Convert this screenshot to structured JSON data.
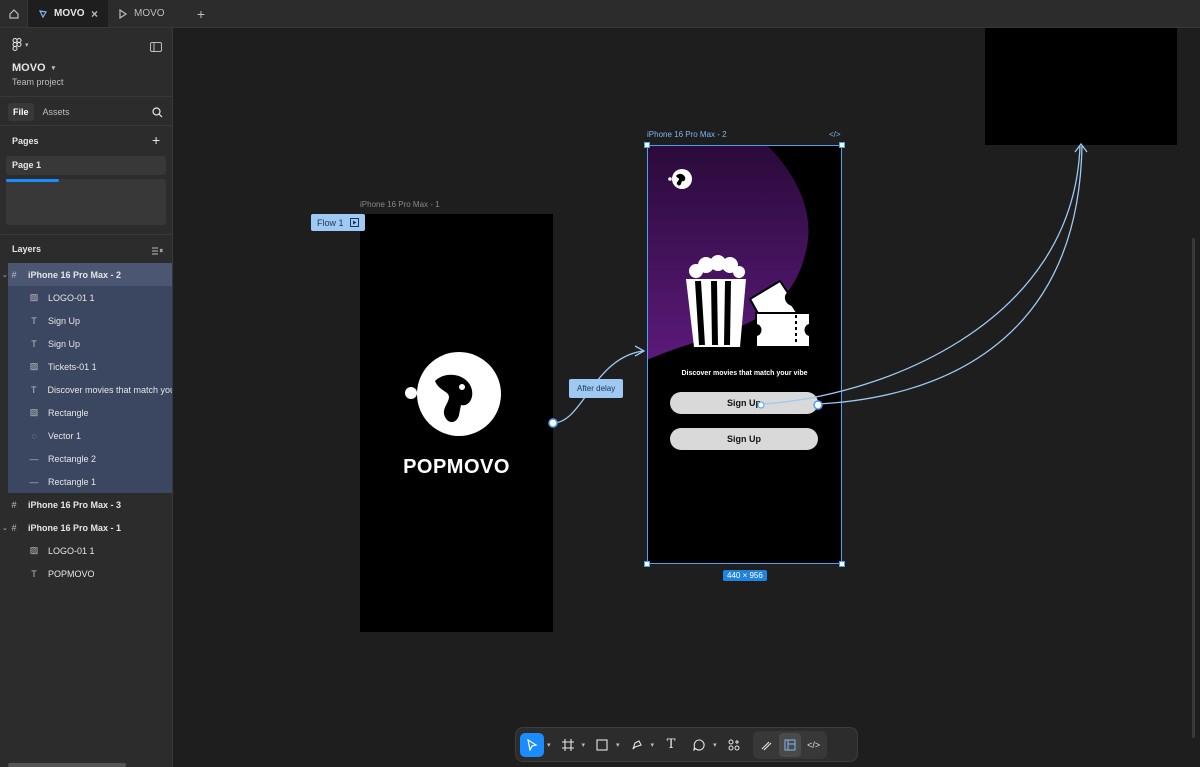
{
  "tabs": [
    {
      "label": "MOVO",
      "active": true
    },
    {
      "label": "MOVO",
      "active": false
    }
  ],
  "project": {
    "name": "MOVO",
    "subtitle": "Team project"
  },
  "sidebar": {
    "file_tab": "File",
    "assets_tab": "Assets",
    "pages_heading": "Pages",
    "pages": [
      "Page 1"
    ],
    "layers_heading": "Layers",
    "layers": [
      {
        "name": "iPhone 16 Pro Max - 2",
        "type": "frame",
        "selected": true
      },
      {
        "name": "LOGO-01 1",
        "type": "image",
        "selected": true
      },
      {
        "name": "Sign Up",
        "type": "text",
        "selected": true
      },
      {
        "name": "Sign Up",
        "type": "text",
        "selected": true
      },
      {
        "name": "Tickets-01 1",
        "type": "image",
        "selected": true
      },
      {
        "name": "Discover movies that match your",
        "type": "text",
        "selected": true
      },
      {
        "name": "Rectangle",
        "type": "image",
        "selected": true
      },
      {
        "name": "Vector 1",
        "type": "vector",
        "selected": true
      },
      {
        "name": "Rectangle 2",
        "type": "line",
        "selected": true
      },
      {
        "name": "Rectangle 1",
        "type": "line",
        "selected": true
      },
      {
        "name": "iPhone 16 Pro Max - 3",
        "type": "frame",
        "selected": false
      },
      {
        "name": "iPhone 16 Pro Max - 1",
        "type": "frame",
        "selected": false
      },
      {
        "name": "LOGO-01 1",
        "type": "image",
        "selected": false
      },
      {
        "name": "POPMOVO",
        "type": "text",
        "selected": false
      }
    ]
  },
  "canvas": {
    "frame1_label": "iPhone 16 Pro Max - 1",
    "frame2_label": "iPhone 16 Pro Max - 2",
    "flow_label": "Flow 1",
    "brand_text": "POPMOVO",
    "tagline": "Discover movies that match your vibe",
    "signup_label": "Sign Up",
    "signup_label_2": "Sign Up",
    "delay_label": "After delay",
    "dimensions": "440 × 956"
  },
  "colors": {
    "accent": "#1a8cff",
    "selection": "#4aa3f0",
    "prototype": "#9ec9f2",
    "purple": "#5b1a7a"
  }
}
